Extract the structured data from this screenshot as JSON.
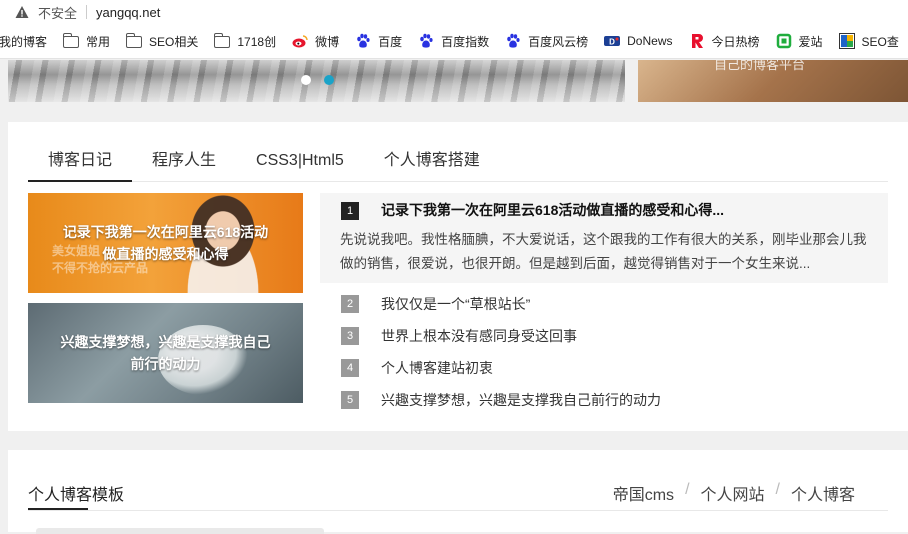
{
  "browser": {
    "security_label": "不安全",
    "url": "yangqq.net"
  },
  "bookmarks": [
    {
      "label": "我的博客",
      "icon": "none"
    },
    {
      "label": "常用",
      "icon": "folder-icon"
    },
    {
      "label": "SEO相关",
      "icon": "folder-icon"
    },
    {
      "label": "1718创",
      "icon": "folder-icon"
    },
    {
      "label": "微博",
      "icon": "weibo-icon"
    },
    {
      "label": "百度",
      "icon": "baidu-paw-icon"
    },
    {
      "label": "百度指数",
      "icon": "baidu-paw-icon"
    },
    {
      "label": "百度风云榜",
      "icon": "baidu-paw-icon"
    },
    {
      "label": "DoNews",
      "icon": "donews-icon"
    },
    {
      "label": "今日热榜",
      "icon": "r-logo-icon"
    },
    {
      "label": "爱站",
      "icon": "aizhan-icon"
    },
    {
      "label": "SEO查",
      "icon": "seo-icon"
    }
  ],
  "banner": {
    "right_caption": "自己的博客平台"
  },
  "blog": {
    "tabs": [
      {
        "label": "博客日记",
        "active": true
      },
      {
        "label": "程序人生",
        "active": false
      },
      {
        "label": "CSS3|Html5",
        "active": false
      },
      {
        "label": "个人博客搭建",
        "active": false
      }
    ],
    "thumbs": [
      {
        "caption": "记录下我第一次在阿里云618活动做直播的感受和心得",
        "ghost": "美女姐姐\n不得不抢的云产品"
      },
      {
        "caption": "兴趣支撑梦想，兴趣是支撑我自己前行的动力"
      }
    ],
    "featured": {
      "rank": "1",
      "title": "记录下我第一次在阿里云618活动做直播的感受和心得...",
      "desc": "先说说我吧。我性格腼腆，不大爱说话，这个跟我的工作有很大的关系，刚毕业那会儿我做的销售，很爱说，也很开朗。但是越到后面，越觉得销售对于一个女生来说..."
    },
    "list": [
      {
        "rank": "2",
        "title": "我仅仅是一个“草根站长”"
      },
      {
        "rank": "3",
        "title": "世界上根本没有感同身受这回事"
      },
      {
        "rank": "4",
        "title": "个人博客建站初衷"
      },
      {
        "rank": "5",
        "title": "兴趣支撑梦想，兴趣是支撑我自己前行的动力"
      }
    ]
  },
  "templates": {
    "title": "个人博客模板",
    "links": [
      "帝国cms",
      "个人网站",
      "个人博客"
    ]
  },
  "colors": {
    "accent_dot": "#1aa3c8",
    "rank_dark": "#222222",
    "rank_light": "#999999"
  }
}
